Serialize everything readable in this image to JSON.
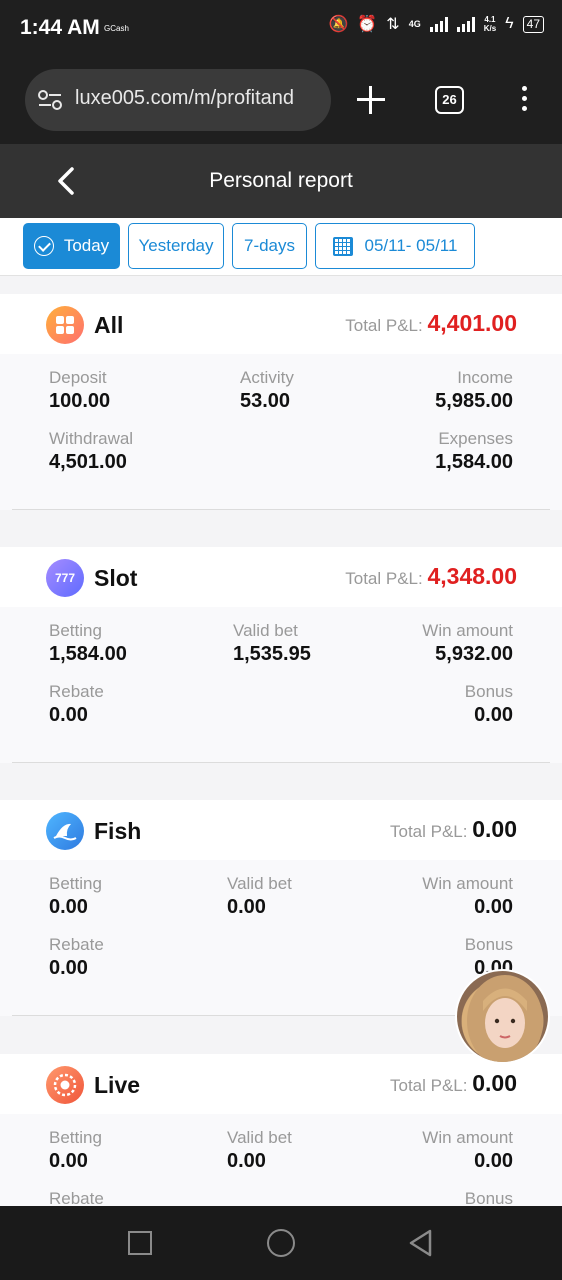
{
  "status_bar": {
    "time": "1:44 AM",
    "notification": "GCash",
    "network": "4G",
    "speed_value": "4.1",
    "speed_unit": "K/s",
    "battery": "47"
  },
  "browser": {
    "url": "luxe005.com/m/profitand",
    "tab_count": "26"
  },
  "header": {
    "title": "Personal report"
  },
  "filters": {
    "today": "Today",
    "yesterday": "Yesterday",
    "seven_days": "7-days",
    "date_range": "05/11- 05/11"
  },
  "sections": [
    {
      "title": "All",
      "pl_label": "Total P&L:",
      "pl_value": "4,401.00",
      "pl_color": "#e02020",
      "row1": [
        {
          "label": "Deposit",
          "value": "100.00"
        },
        {
          "label": "Activity",
          "value": "53.00"
        },
        {
          "label": "Income",
          "value": "5,985.00"
        }
      ],
      "row2": [
        {
          "label": "Withdrawal",
          "value": "4,501.00"
        },
        {
          "label": "Expenses",
          "value": "1,584.00"
        }
      ]
    },
    {
      "title": "Slot",
      "pl_label": "Total P&L:",
      "pl_value": "4,348.00",
      "pl_color": "#e02020",
      "row1": [
        {
          "label": "Betting",
          "value": "1,584.00"
        },
        {
          "label": "Valid bet",
          "value": "1,535.95"
        },
        {
          "label": "Win amount",
          "value": "5,932.00"
        }
      ],
      "row2": [
        {
          "label": "Rebate",
          "value": "0.00"
        },
        {
          "label": "Bonus",
          "value": "0.00"
        }
      ]
    },
    {
      "title": "Fish",
      "pl_label": "Total P&L:",
      "pl_value": "0.00",
      "pl_color": "#111111",
      "row1": [
        {
          "label": "Betting",
          "value": "0.00"
        },
        {
          "label": "Valid bet",
          "value": "0.00"
        },
        {
          "label": "Win amount",
          "value": "0.00"
        }
      ],
      "row2": [
        {
          "label": "Rebate",
          "value": "0.00"
        },
        {
          "label": "Bonus",
          "value": "0.00"
        }
      ]
    },
    {
      "title": "Live",
      "pl_label": "Total P&L:",
      "pl_value": "0.00",
      "pl_color": "#111111",
      "row1": [
        {
          "label": "Betting",
          "value": "0.00"
        },
        {
          "label": "Valid bet",
          "value": "0.00"
        },
        {
          "label": "Win amount",
          "value": "0.00"
        }
      ],
      "row2": [
        {
          "label": "Rebate",
          "value": ""
        },
        {
          "label": "Bonus",
          "value": ""
        }
      ]
    }
  ],
  "icons": {
    "all": "grid-icon",
    "slot": "777-icon",
    "fish": "shark-fin-icon",
    "live": "roulette-icon"
  },
  "accent_color": "#1b8ad6"
}
